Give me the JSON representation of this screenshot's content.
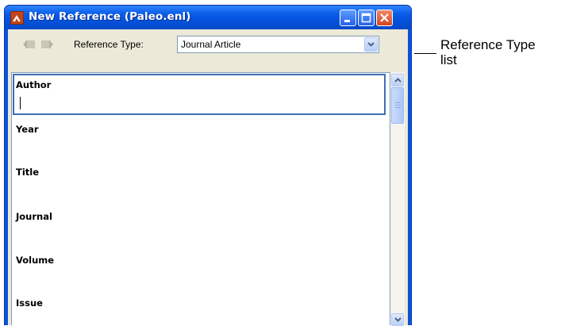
{
  "window": {
    "title": "New Reference (Paleo.enl)",
    "icon": "endnote-app-icon",
    "controls": [
      "minimize-icon",
      "maximize-icon",
      "close-icon"
    ]
  },
  "toolbar": {
    "icons": [
      "previous-reference-icon",
      "next-reference-icon"
    ],
    "reference_type_label": "Reference Type:",
    "reference_type_value": "Journal Article"
  },
  "fields": [
    {
      "label": "Author",
      "value": "",
      "active": true
    },
    {
      "label": "Year",
      "value": ""
    },
    {
      "label": "Title",
      "value": ""
    },
    {
      "label": "Journal",
      "value": ""
    },
    {
      "label": "Volume",
      "value": ""
    },
    {
      "label": "Issue",
      "value": ""
    }
  ],
  "callout": {
    "line1": "Reference Type",
    "line2": "list"
  },
  "colors": {
    "titlebar": "#0a5ce8",
    "client_background": "#ece9d8",
    "active_field_border": "#3d6fb3",
    "close_button": "#d5451f"
  }
}
